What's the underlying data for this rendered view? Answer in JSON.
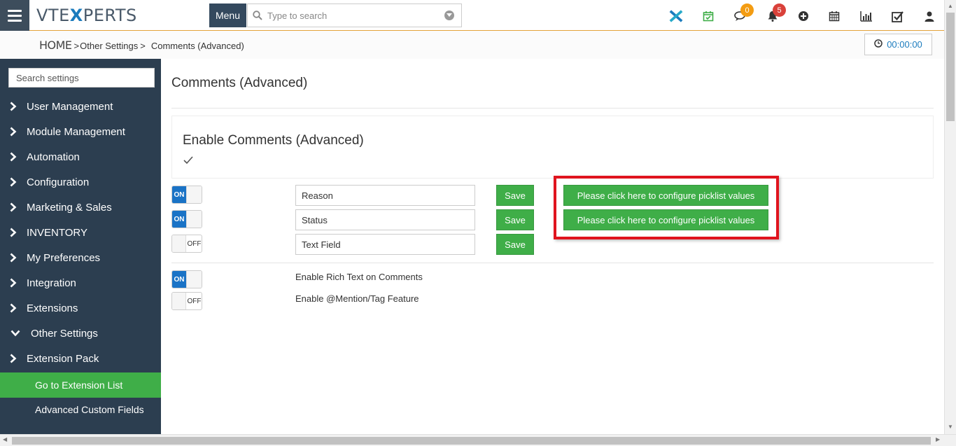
{
  "header": {
    "logo_left": "VTE",
    "logo_x": "X",
    "logo_right": "PERTS",
    "menu_label": "Menu",
    "search_placeholder": "Type to search",
    "chat_badge": "0",
    "notif_badge": "5"
  },
  "breadcrumb": {
    "home": "HOME",
    "sep1": ">",
    "level1": "Other Settings",
    "sep2": ">",
    "level2": "Comments (Advanced)"
  },
  "timer": {
    "value": "00:00:00"
  },
  "sidebar": {
    "search_placeholder": "Search settings",
    "items": [
      {
        "label": "User Management",
        "expanded": false
      },
      {
        "label": "Module Management",
        "expanded": false
      },
      {
        "label": "Automation",
        "expanded": false
      },
      {
        "label": "Configuration",
        "expanded": false
      },
      {
        "label": "Marketing & Sales",
        "expanded": false
      },
      {
        "label": "INVENTORY",
        "expanded": false
      },
      {
        "label": "My Preferences",
        "expanded": false
      },
      {
        "label": "Integration",
        "expanded": false
      },
      {
        "label": "Extensions",
        "expanded": false
      },
      {
        "label": "Other Settings",
        "expanded": true
      },
      {
        "label": "Extension Pack",
        "expanded": false
      }
    ],
    "subitems": [
      {
        "label": "Go to Extension List",
        "active": true
      },
      {
        "label": "Advanced Custom Fields",
        "active": false
      }
    ]
  },
  "main": {
    "page_title": "Comments (Advanced)",
    "panel_title": "Enable Comments (Advanced)",
    "enable_checked": true,
    "fields": [
      {
        "toggle": "ON",
        "value": "Reason",
        "save": "Save",
        "picklist": "Please click here to configure picklist values"
      },
      {
        "toggle": "ON",
        "value": "Status",
        "save": "Save",
        "picklist": "Please click here to configure picklist values"
      },
      {
        "toggle": "OFF",
        "value": "Text Field",
        "save": "Save",
        "picklist": ""
      }
    ],
    "options": [
      {
        "toggle": "ON",
        "label": "Enable Rich Text on Comments"
      },
      {
        "toggle": "OFF",
        "label": "Enable @Mention/Tag Feature"
      }
    ]
  },
  "colors": {
    "accent_green": "#3fae48",
    "sidebar_bg": "#2c3e50",
    "toggle_blue": "#1a73c6",
    "highlight_red": "#e0141e"
  },
  "icons": {
    "top": [
      "vtexperts-x-icon",
      "calendar-check-icon",
      "chat-icon",
      "bell-icon",
      "plus-circle-icon",
      "calendar-icon",
      "bar-chart-icon",
      "checkbox-icon",
      "user-icon"
    ]
  }
}
